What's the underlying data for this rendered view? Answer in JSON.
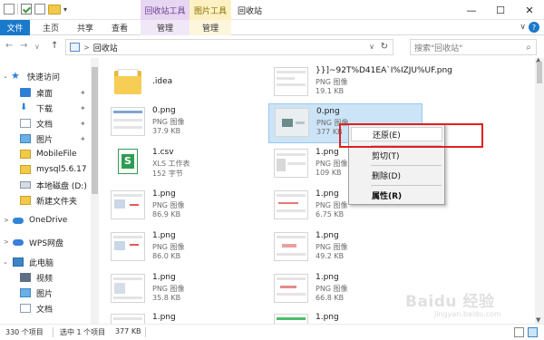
{
  "titlebar": {
    "title": "回收站",
    "context_groups": [
      "回收站工具",
      "图片工具"
    ],
    "quick_access_arrow": "▾",
    "buttons": {
      "minimize": "—",
      "maximize": "☐",
      "close": "✕"
    }
  },
  "ribbon": {
    "tabs": [
      "文件",
      "主页",
      "共享",
      "查看",
      "管理",
      "管理"
    ],
    "toggle": "∨",
    "help": "?"
  },
  "nav": {
    "back": "←",
    "forward": "→",
    "recent": "∨",
    "up": "↑",
    "address": "回收站",
    "address_arrow": ">",
    "dropdown": "∨",
    "refresh": "↻",
    "search_placeholder": "搜索\"回收站\"",
    "search_icon": "🔍"
  },
  "sidebar": {
    "items": [
      {
        "label": "快速访问",
        "icon": "star-icon"
      },
      {
        "label": "桌面",
        "icon": "desktop-icon",
        "pinned": true
      },
      {
        "label": "下载",
        "icon": "download-icon",
        "pinned": true
      },
      {
        "label": "文档",
        "icon": "document-icon",
        "pinned": true
      },
      {
        "label": "图片",
        "icon": "picture-icon",
        "pinned": true
      },
      {
        "label": "MobileFile",
        "icon": "folder-icon"
      },
      {
        "label": "mysql5.6.17",
        "icon": "folder-icon"
      },
      {
        "label": "本地磁盘 (D:)",
        "icon": "drive-icon"
      },
      {
        "label": "新建文件夹",
        "icon": "folder-icon"
      },
      {
        "label": "OneDrive",
        "icon": "cloud-icon"
      },
      {
        "label": "WPS网盘",
        "icon": "cloud-icon"
      },
      {
        "label": "此电脑",
        "icon": "computer-icon"
      },
      {
        "label": "视频",
        "icon": "video-icon"
      },
      {
        "label": "图片",
        "icon": "picture-icon"
      },
      {
        "label": "文档",
        "icon": "document-icon"
      }
    ],
    "pin_glyph": "✦",
    "expand_glyph": ">"
  },
  "files": [
    {
      "name": ".idea",
      "type": "",
      "size": "",
      "kind": "folder"
    },
    {
      "name": "}}]~92T%D41EA`I%IZJU%UF.png",
      "type": "PNG 图像",
      "size": "19.1 KB",
      "kind": "png"
    },
    {
      "name": "0.png",
      "type": "PNG 图像",
      "size": "37.9 KB",
      "kind": "png"
    },
    {
      "name": "0.png",
      "type": "PNG 图像",
      "size": "377 KB",
      "kind": "png",
      "selected": true
    },
    {
      "name": "1.csv",
      "type": "XLS 工作表",
      "size": "152 字节",
      "kind": "xls"
    },
    {
      "name": "1.png",
      "type": "PNG 图像",
      "size": "109 KB",
      "kind": "png"
    },
    {
      "name": "1.png",
      "type": "PNG 图像",
      "size": "86.9 KB",
      "kind": "png"
    },
    {
      "name": "1.png",
      "type": "PNG 图像",
      "size": "6.75 KB",
      "kind": "png"
    },
    {
      "name": "1.png",
      "type": "PNG 图像",
      "size": "86.0 KB",
      "kind": "png"
    },
    {
      "name": "1.png",
      "type": "PNG 图像",
      "size": "49.2 KB",
      "kind": "png"
    },
    {
      "name": "1.png",
      "type": "PNG 图像",
      "size": "35.8 KB",
      "kind": "png"
    },
    {
      "name": "1.png",
      "type": "PNG 图像",
      "size": "66.8 KB",
      "kind": "png"
    },
    {
      "name": "1.png",
      "type": "",
      "size": "",
      "kind": "png"
    },
    {
      "name": "1.png",
      "type": "",
      "size": "",
      "kind": "png"
    }
  ],
  "context_menu": {
    "items": [
      "还原(E)",
      "剪切(T)",
      "删除(D)",
      "属性(R)"
    ]
  },
  "status": {
    "count": "330 个项目",
    "selected": "选中 1 个项目",
    "size": "377 KB"
  },
  "watermark": {
    "main": "Baidu 经验",
    "sub": "jingyan.baidu.com"
  },
  "colors": {
    "accent": "#1979ca",
    "selection": "#cce4f7",
    "highlight_box": "#e02020",
    "recycle_tools": "#e7d6f2",
    "picture_tools": "#fdf1c4"
  }
}
